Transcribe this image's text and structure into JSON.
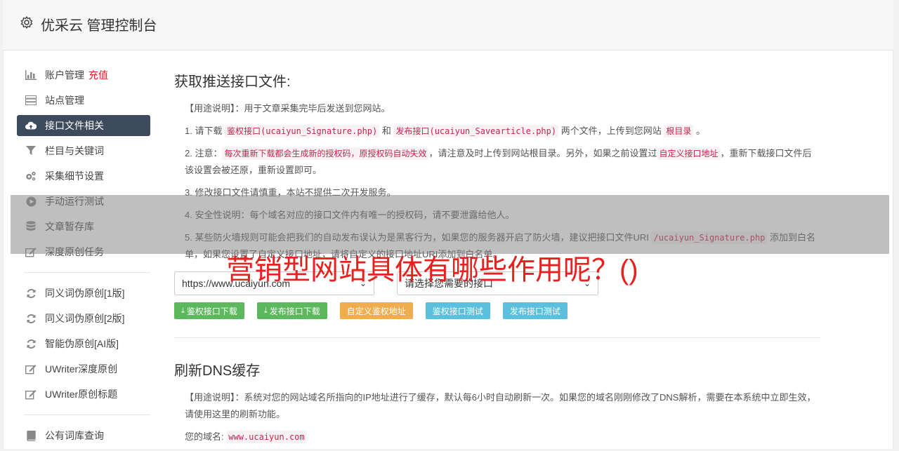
{
  "header": {
    "title": "优采云 管理控制台",
    "icon": "gear-icon"
  },
  "sidebar": {
    "groups": [
      [
        {
          "label": "账户管理",
          "extra": "充值",
          "icon": "bar-chart-icon"
        },
        {
          "label": "站点管理",
          "icon": "server-icon"
        },
        {
          "label": "接口文件相关",
          "icon": "cloud-upload-icon",
          "active": true
        },
        {
          "label": "栏目与关键词",
          "icon": "filter-icon"
        },
        {
          "label": "采集细节设置",
          "icon": "cogs-icon"
        },
        {
          "label": "手动运行测试",
          "icon": "play-circle-icon"
        },
        {
          "label": "文章暂存库",
          "icon": "database-icon"
        },
        {
          "label": "深度原创任务",
          "icon": "edit-icon"
        }
      ],
      [
        {
          "label": "同义词伪原创[1版]",
          "icon": "refresh-icon"
        },
        {
          "label": "同义词伪原创[2版]",
          "icon": "refresh-icon"
        },
        {
          "label": "智能伪原创[AI版]",
          "icon": "refresh-icon"
        },
        {
          "label": "UWriter深度原创",
          "icon": "edit-icon"
        },
        {
          "label": "UWriter原创标题",
          "icon": "edit-icon"
        }
      ],
      [
        {
          "label": "公有词库查询",
          "icon": "book-icon"
        }
      ]
    ]
  },
  "section1": {
    "title": "获取推送接口文件:",
    "usage_label": "【用途说明】",
    "usage_text": "：用于文章采集完毕后发送到您网站。",
    "p1_a": "1. 请下载 ",
    "p1_code1": "鉴权接口(ucaiyun_Signature.php)",
    "p1_b": " 和 ",
    "p1_code2": "发布接口(ucaiyun_Savearticle.php)",
    "p1_c": " 两个文件，上传到您网站 ",
    "p1_code3": "根目录",
    "p1_d": " 。",
    "p2_a": "2. 注意：",
    "p2_code1": "每次重新下载都会生成新的授权码，原授权码自动失效",
    "p2_b": "，请注意及时上传到网站根目录。另外，如果之前设置过",
    "p2_code2": "自定义接口地址",
    "p2_c": "，重新下载接口文件后该设置会被还原，重新设置即可。",
    "p3": "3. 修改接口文件请慎重，本站不提供二次开发服务。",
    "p4": "4. 安全性说明：每个域名对应的接口文件内有唯一的授权码，请不要泄露给他人。",
    "p5_a": "5. 某些防火墙规则可能会把我们的自动发布误认为是黑客行为，如果您的服务器开启了防火墙，建议把接口文件URI ",
    "p5_code": "/ucaiyun_Signature.php",
    "p5_b": " 添加到白名单，如果您设置了自定义接口地址，请将自定义的接口地址URI添加到白名单。",
    "select1": "https://www.ucaiyun.com",
    "select2": "请选择您需要的接口",
    "buttons": [
      "鉴权接口下载",
      "发布接口下载",
      "自定义鉴权地址",
      "鉴权接口测试",
      "发布接口测试"
    ]
  },
  "section2": {
    "title": "刷新DNS缓存",
    "usage_label": "【用途说明】",
    "usage_text": "：系统对您的网站域名所指向的IP地址进行了缓存，默认每6小时自动刷新一次。如果您的域名刚刚修改了DNS解析，需要在本系统中立即生效，请使用这里的刷新功能。",
    "domain_label": "您的域名:",
    "domain_value": "www.ucaiyun.com"
  },
  "overlay": {
    "title": "营销型网站具体有哪些作用呢？()"
  }
}
